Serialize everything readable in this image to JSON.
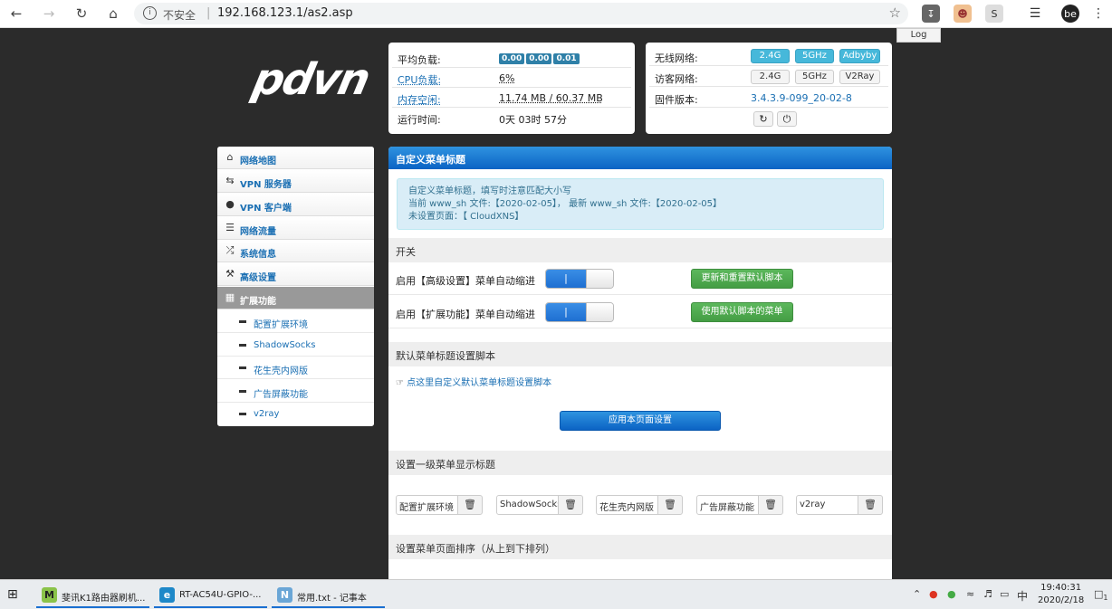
{
  "browser": {
    "insecure_label": "不安全",
    "url": "192.168.123.1/as2.asp",
    "log_tooltip": "Log",
    "profile_initial": "be"
  },
  "status": {
    "load_label": "平均负载:",
    "load_values": [
      "0.00",
      "0.00",
      "0.01"
    ],
    "cpu_label": "CPU负载:",
    "cpu_value": "6%",
    "mem_label": "内存空闲:",
    "mem_value": "11.74 MB / 60.37 MB",
    "uptime_label": "运行时间:",
    "uptime_value": "0天 03时 57分"
  },
  "network": {
    "wireless_label": "无线网络:",
    "wireless_buttons": [
      "2.4G",
      "5GHz",
      "Adbyby"
    ],
    "guest_label": "访客网络:",
    "guest_buttons": [
      "2.4G",
      "5GHz",
      "V2Ray"
    ],
    "firmware_label": "固件版本:",
    "firmware_value": "3.4.3.9-099_20-02-8"
  },
  "sidebar": {
    "items": [
      {
        "label": "网络地图",
        "icon": "home-icon"
      },
      {
        "label": "VPN 服务器",
        "icon": "retweet-icon"
      },
      {
        "label": "VPN 客户端",
        "icon": "globe-icon"
      },
      {
        "label": "网络流量",
        "icon": "list-icon"
      },
      {
        "label": "系统信息",
        "icon": "random-icon"
      },
      {
        "label": "高级设置",
        "icon": "wrench-icon"
      },
      {
        "label": "扩展功能",
        "icon": "grid-icon"
      }
    ],
    "subitems": [
      "配置扩展环境",
      "ShadowSocks",
      "花生壳内网版",
      "广告屏蔽功能",
      "v2ray"
    ]
  },
  "main": {
    "title": "自定义菜单标题",
    "info_line1": "自定义菜单标题，填写时注意匹配大小写",
    "info_line2": "当前 www_sh 文件:【2020-02-05】， 最新 www_sh 文件:【2020-02-05】",
    "info_line3": "未设置页面：【 CloudXNS】",
    "switch_section": "开关",
    "row1_label": "启用【高级设置】菜单自动缩进",
    "row1_button": "更新和重置默认脚本",
    "row2_label": "启用【扩展功能】菜单自动缩进",
    "row2_button": "使用默认脚本的菜单",
    "toggle_on_text": "|",
    "script_section": "默认菜单标题设置脚本",
    "script_link": "点这里自定义默认菜单标题设置脚本",
    "apply_button": "应用本页面设置",
    "level1_section": "设置一级菜单显示标题",
    "menu_inputs": [
      "配置扩展环境",
      "ShadowSocks",
      "花生壳内网版",
      "广告屏蔽功能",
      "v2ray"
    ],
    "order_section": "设置菜单页面排序（从上到下排列）"
  },
  "taskbar": {
    "apps": [
      {
        "label": "斐讯K1路由器刷机...",
        "icon": "M"
      },
      {
        "label": "RT-AC54U-GPIO-...",
        "icon": "e"
      },
      {
        "label": "常用.txt - 记事本",
        "icon": "N"
      }
    ],
    "ime": "中",
    "time": "19:40:31",
    "date": "2020/2/18",
    "notification_count": "1"
  }
}
